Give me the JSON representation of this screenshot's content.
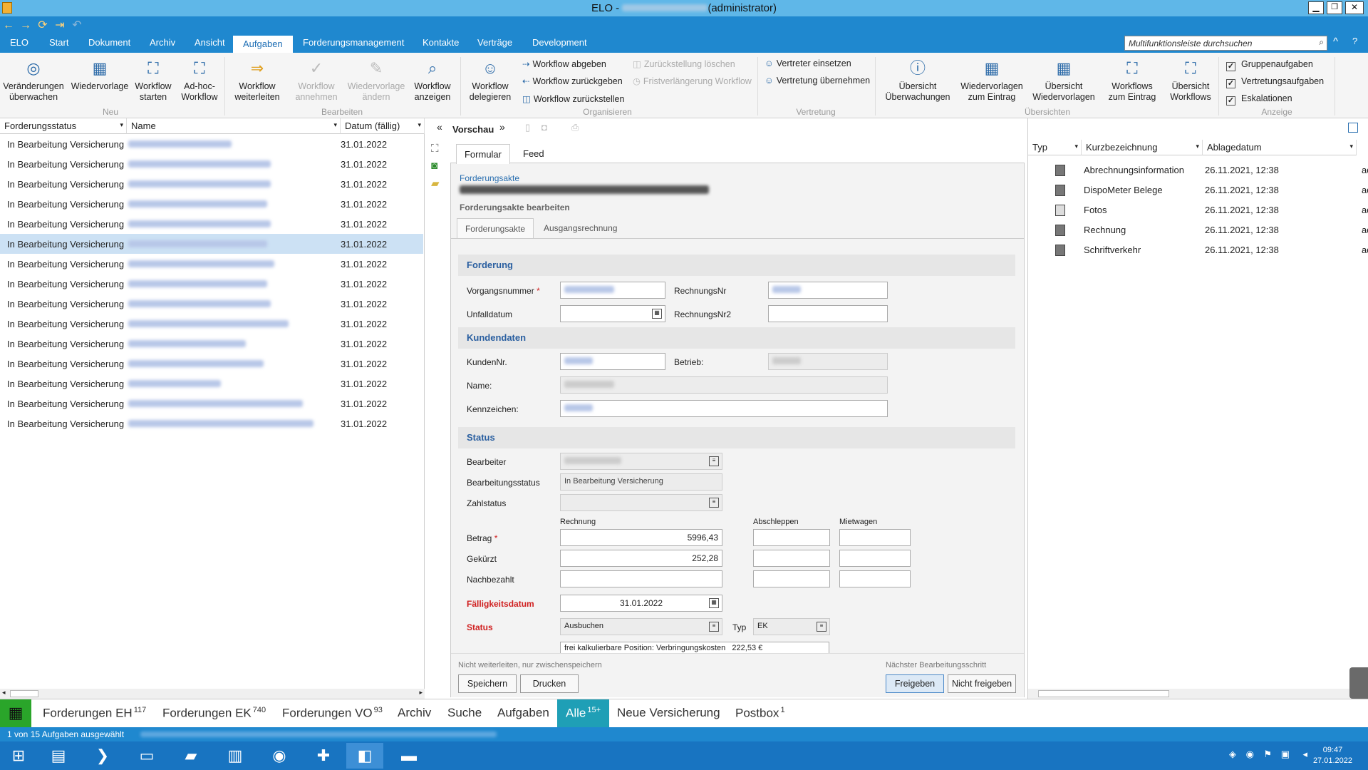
{
  "window": {
    "title": "ELO - ",
    "user_role": "(administrator)"
  },
  "menu": {
    "tabs": [
      "ELO",
      "Start",
      "Dokument",
      "Archiv",
      "Ansicht",
      "Aufgaben",
      "Forderungsmanagement",
      "Kontakte",
      "Verträge",
      "Development"
    ],
    "active": "Aufgaben",
    "search_placeholder": "Multifunktionsleiste durchsuchen"
  },
  "ribbon": {
    "neu": {
      "label": "Neu",
      "b1": "Veränderungen überwachen",
      "b2": "Wiedervorlage",
      "b3": "Workflow starten",
      "b4": "Ad-hoc-Workflow"
    },
    "bearbeiten": {
      "label": "Bearbeiten",
      "b1": "Workflow weiterleiten",
      "b2": "Workflow annehmen",
      "b3": "Wiedervorlage ändern",
      "b4": "Workflow anzeigen"
    },
    "organisieren": {
      "label": "Organisieren",
      "b1": "Workflow delegieren",
      "s1": "Workflow abgeben",
      "s2": "Workflow zurückgeben",
      "s3": "Workflow zurückstellen",
      "s4": "Zurückstellung löschen",
      "s5": "Fristverlängerung Workflow"
    },
    "vertretung": {
      "label": "Vertretung",
      "s1": "Vertreter einsetzen",
      "s2": "Vertretung übernehmen"
    },
    "uebersichten": {
      "label": "Übersichten",
      "b1": "Übersicht Überwachungen",
      "b2": "Wiedervorlagen zum Eintrag",
      "b3": "Übersicht Wiedervorlagen",
      "b4": "Workflows zum Eintrag",
      "b5": "Übersicht Workflows"
    },
    "anzeige": {
      "label": "Anzeige",
      "c1": "Gruppenaufgaben",
      "c2": "Vertretungsaufgaben",
      "c3": "Eskalationen"
    }
  },
  "tasklist": {
    "columns": [
      "Forderungsstatus",
      "Name",
      "Datum (fällig)"
    ],
    "rows": [
      {
        "status": "In Bearbeitung Versicherung",
        "date": "31.01.2022"
      },
      {
        "status": "In Bearbeitung Versicherung",
        "date": "31.01.2022"
      },
      {
        "status": "In Bearbeitung Versicherung",
        "date": "31.01.2022"
      },
      {
        "status": "In Bearbeitung Versicherung",
        "date": "31.01.2022"
      },
      {
        "status": "In Bearbeitung Versicherung",
        "date": "31.01.2022"
      },
      {
        "status": "In Bearbeitung Versicherung",
        "date": "31.01.2022"
      },
      {
        "status": "In Bearbeitung Versicherung",
        "date": "31.01.2022"
      },
      {
        "status": "In Bearbeitung Versicherung",
        "date": "31.01.2022"
      },
      {
        "status": "In Bearbeitung Versicherung",
        "date": "31.01.2022"
      },
      {
        "status": "In Bearbeitung Versicherung",
        "date": "31.01.2022"
      },
      {
        "status": "In Bearbeitung Versicherung",
        "date": "31.01.2022"
      },
      {
        "status": "In Bearbeitung Versicherung",
        "date": "31.01.2022"
      },
      {
        "status": "In Bearbeitung Versicherung",
        "date": "31.01.2022"
      },
      {
        "status": "In Bearbeitung Versicherung",
        "date": "31.01.2022"
      },
      {
        "status": "In Bearbeitung Versicherung",
        "date": "31.01.2022"
      }
    ]
  },
  "preview": {
    "label": "Vorschau",
    "tab_formular": "Formular",
    "tab_feed": "Feed"
  },
  "form": {
    "breadcrumb": "Forderungsakte",
    "subtitle": "Forderungsakte bearbeiten",
    "tab1": "Forderungsakte",
    "tab2": "Ausgangsrechnung",
    "sec_forderung": "Forderung",
    "vorgangsnummer": "Vorgangsnummer",
    "rechnungsnr": "RechnungsNr",
    "unfalldatum": "Unfalldatum",
    "rechnungsnr2": "RechnungsNr2",
    "sec_kunden": "Kundendaten",
    "kundennr": "KundenNr.",
    "betrieb": "Betrieb:",
    "name": "Name:",
    "kennzeichen": "Kennzeichen:",
    "sec_status": "Status",
    "bearbeiter": "Bearbeiter",
    "bearbeitungsstatus": "Bearbeitungsstatus",
    "bearbeitungsstatus_value": "In Bearbeitung Versicherung",
    "zahlstatus": "Zahlstatus",
    "col_rechnung": "Rechnung",
    "col_abschleppen": "Abschleppen",
    "col_mietwagen": "Mietwagen",
    "betrag": "Betrag",
    "betrag_value": "5996,43",
    "gekuerzt": "Gekürzt",
    "gekuerzt_value": "252,28",
    "nachbezahlt": "Nachbezahlt",
    "faelligkeit": "Fälligkeitsdatum",
    "faelligkeit_value": "31.01.2022",
    "status": "Status",
    "status_value": "Ausbuchen",
    "typ": "Typ",
    "typ_value": "EK",
    "position": "frei kalkulierbare Position: Verbringungskosten",
    "position_value": "222,53 €",
    "hint_left": "Nicht weiterleiten, nur zwischenspeichern",
    "hint_right": "Nächster Bearbeitungsschritt",
    "btn_speichern": "Speichern",
    "btn_drucken": "Drucken",
    "btn_freigeben": "Freigeben",
    "btn_nicht": "Nicht freigeben"
  },
  "documents": {
    "columns": [
      "Typ",
      "Kurzbezeichnung",
      "Ablagedatum"
    ],
    "rows": [
      {
        "name": "Abrechnungsinformation",
        "date": "26.11.2021, 12:38",
        "extra": "ad"
      },
      {
        "name": "DispoMeter Belege",
        "date": "26.11.2021, 12:38",
        "extra": "ad"
      },
      {
        "name": "Fotos",
        "date": "26.11.2021, 12:38",
        "extra": "ad"
      },
      {
        "name": "Rechnung",
        "date": "26.11.2021, 12:38",
        "extra": "ad"
      },
      {
        "name": "Schriftverkehr",
        "date": "26.11.2021, 12:38",
        "extra": "ad"
      }
    ]
  },
  "bottomtabs": [
    {
      "label": "Forderungen EH",
      "count": "117"
    },
    {
      "label": "Forderungen EK",
      "count": "740"
    },
    {
      "label": "Forderungen VO",
      "count": "93"
    },
    {
      "label": "Archiv",
      "count": ""
    },
    {
      "label": "Suche",
      "count": ""
    },
    {
      "label": "Aufgaben",
      "count": ""
    },
    {
      "label": "Alle",
      "count": "15+"
    },
    {
      "label": "Neue Versicherung",
      "count": ""
    },
    {
      "label": "Postbox",
      "count": "1"
    }
  ],
  "status": {
    "text": "1 von 15 Aufgaben ausgewählt"
  },
  "clock": {
    "time": "09:47",
    "date": "27.01.2022"
  }
}
